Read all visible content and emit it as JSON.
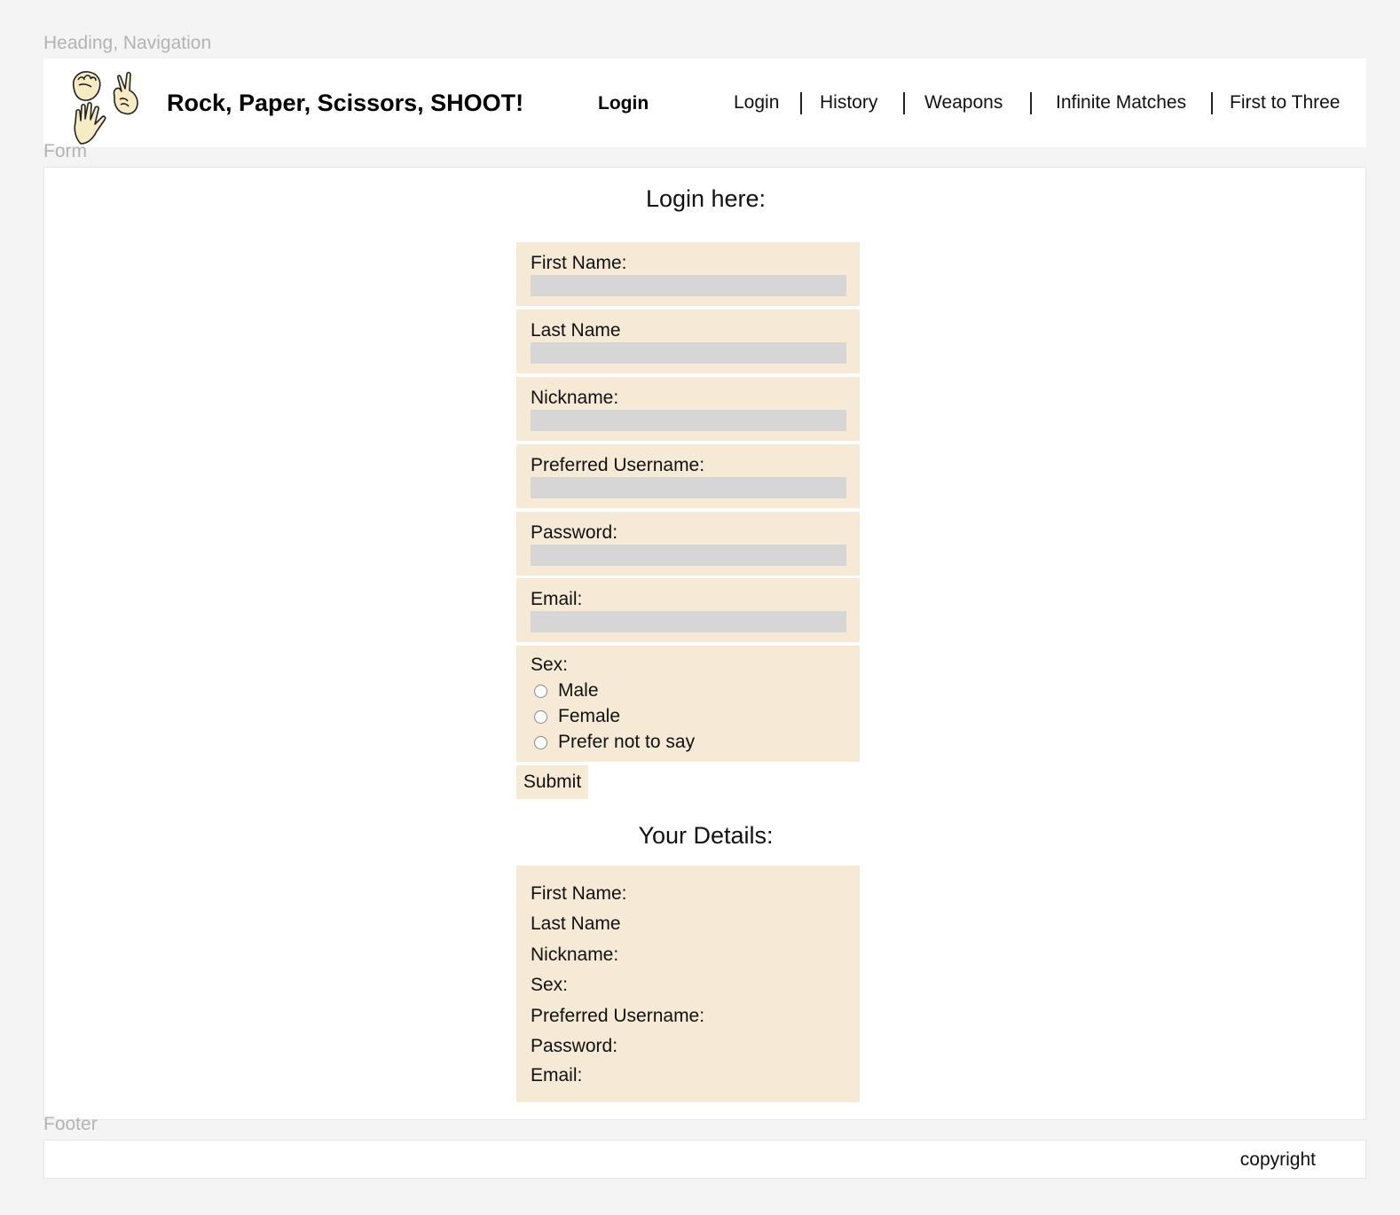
{
  "sections": {
    "header_label": "Heading, Navigation",
    "form_label": "Form",
    "footer_label": "Footer"
  },
  "header": {
    "logo_icon": "rock-paper-scissors-hands-icon",
    "site_title": "Rock, Paper, Scissors, SHOOT!",
    "current_page": "Login",
    "nav": [
      "Login",
      "History",
      "Weapons",
      "Infinite Matches",
      "First to Three"
    ]
  },
  "form": {
    "title": "Login here:",
    "fields": [
      {
        "label": "First Name:",
        "value": ""
      },
      {
        "label": "Last Name",
        "value": ""
      },
      {
        "label": "Nickname:",
        "value": ""
      },
      {
        "label": "Preferred Username:",
        "value": ""
      },
      {
        "label": "Password:",
        "value": ""
      },
      {
        "label": "Email:",
        "value": ""
      }
    ],
    "sex": {
      "label": "Sex:",
      "options": [
        "Male",
        "Female",
        "Prefer not to say"
      ],
      "selected": null
    },
    "submit_label": "Submit"
  },
  "details": {
    "title": "Your Details:",
    "lines": [
      "First Name:",
      "Last Name",
      "Nickname:",
      "Sex:",
      "Preferred Username:",
      "Password:",
      "Email:"
    ]
  },
  "footer": {
    "copyright": "copyright"
  },
  "colors": {
    "page_bg": "#f4f4f4",
    "panel_bg": "#ffffff",
    "field_bg": "#f6ead6",
    "input_bg": "#d6d6d6",
    "section_label": "#b3b3b3"
  }
}
